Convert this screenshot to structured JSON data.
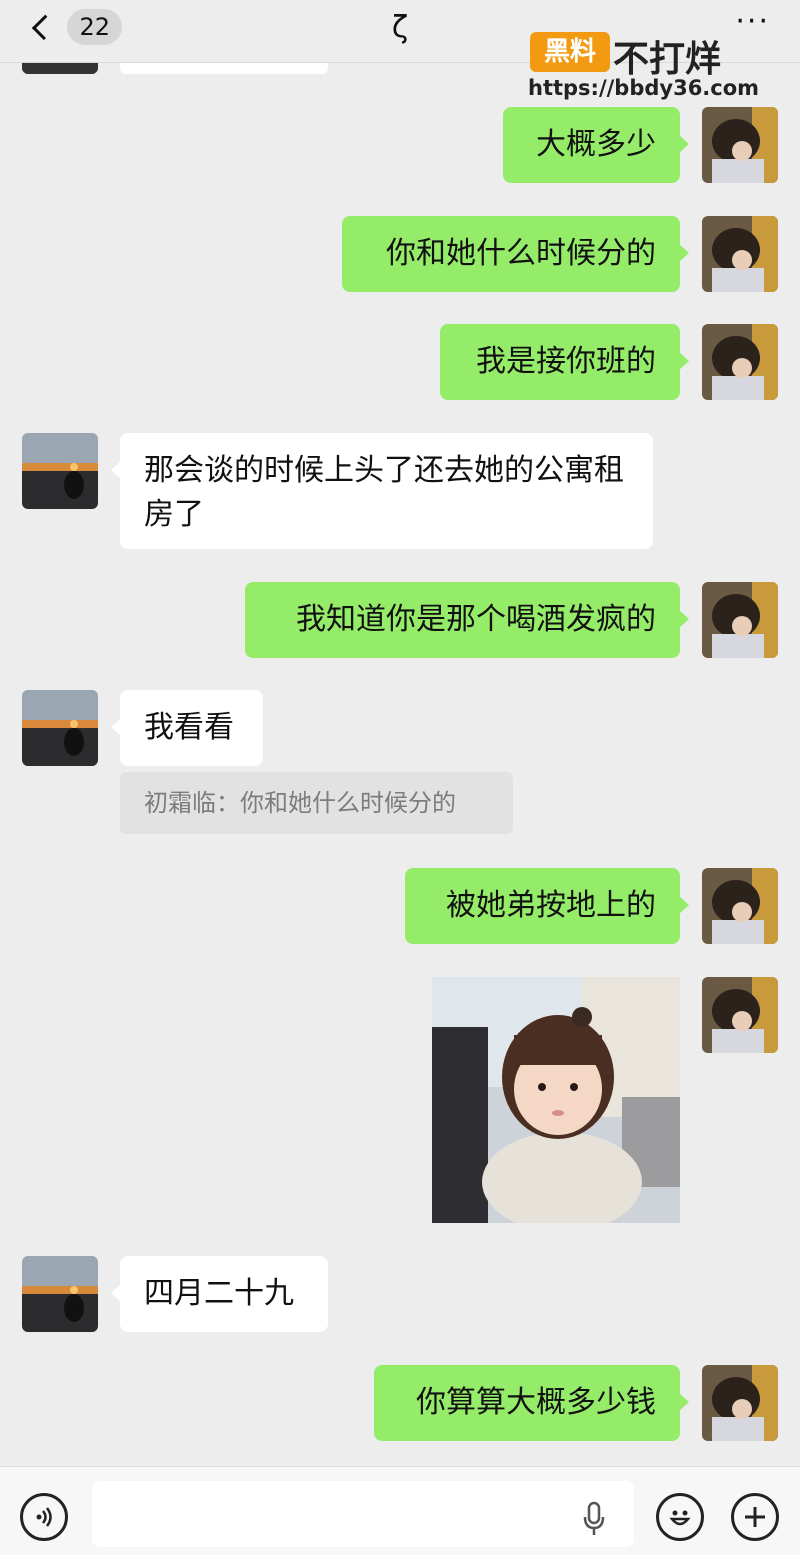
{
  "header": {
    "back_count": "22",
    "title": "ζ",
    "more": "···"
  },
  "watermark": {
    "logo_text": "黑料",
    "name": "不打烊",
    "url": "https://bbdy36.com"
  },
  "messages": [
    {
      "side": "right",
      "text": "大概多少"
    },
    {
      "side": "right",
      "text": "你和她什么时候分的"
    },
    {
      "side": "right",
      "text": "我是接你班的"
    },
    {
      "side": "left",
      "text": "那会谈的时候上头了还去她的公寓租房了"
    },
    {
      "side": "right",
      "text": "我知道你是那个喝酒发疯的"
    },
    {
      "side": "left",
      "text": "我看看",
      "quote": "初霜临：你和她什么时候分的"
    },
    {
      "side": "right",
      "text": "被她弟按地上的"
    },
    {
      "side": "right",
      "type": "image",
      "image": "toddler-sticker"
    },
    {
      "side": "left",
      "text": "四月二十九"
    },
    {
      "side": "right",
      "text": "你算算大概多少钱"
    }
  ],
  "input_bar": {
    "voice_icon": "voice-icon",
    "mic_icon": "microphone-icon",
    "emoji_icon": "emoji-icon",
    "plus_icon": "plus-icon"
  },
  "colors": {
    "my_bubble": "#95ec69",
    "other_bubble": "#ffffff",
    "background": "#ededed",
    "watermark_logo": "#f29b12"
  }
}
